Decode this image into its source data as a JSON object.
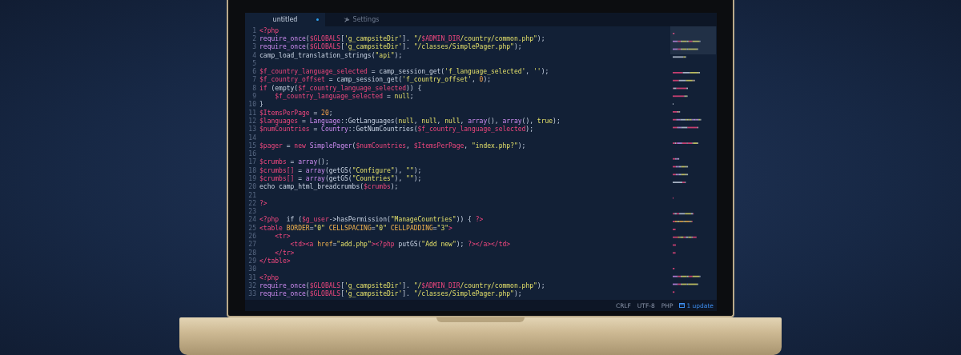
{
  "editor": {
    "tabs": [
      {
        "label": "untitled",
        "selected": true,
        "modified": true,
        "kind": "file"
      },
      {
        "label": "Settings",
        "selected": false,
        "modified": false,
        "kind": "settings"
      }
    ],
    "lines": [
      {
        "number": "1",
        "tokens": [
          {
            "kind": "tag",
            "text": "<?php"
          }
        ]
      },
      {
        "number": "2",
        "tokens": [
          {
            "kind": "func",
            "text": "require_once"
          },
          {
            "kind": "plain",
            "text": "("
          },
          {
            "kind": "var",
            "text": "$GLOBALS"
          },
          {
            "kind": "plain",
            "text": "["
          },
          {
            "kind": "str",
            "text": "'g_campsiteDir'"
          },
          {
            "kind": "plain",
            "text": "]. "
          },
          {
            "kind": "str",
            "text": "\"/"
          },
          {
            "kind": "var",
            "text": "$ADMIN_DIR"
          },
          {
            "kind": "str",
            "text": "/country/common.php\""
          },
          {
            "kind": "plain",
            "text": ");"
          }
        ]
      },
      {
        "number": "3",
        "tokens": [
          {
            "kind": "func",
            "text": "require_once"
          },
          {
            "kind": "plain",
            "text": "("
          },
          {
            "kind": "var",
            "text": "$GLOBALS"
          },
          {
            "kind": "plain",
            "text": "["
          },
          {
            "kind": "str",
            "text": "'g_campsiteDir'"
          },
          {
            "kind": "plain",
            "text": "]. "
          },
          {
            "kind": "str",
            "text": "\"/classes/SimplePager.php\""
          },
          {
            "kind": "plain",
            "text": ");"
          }
        ]
      },
      {
        "number": "4",
        "tokens": [
          {
            "kind": "plain",
            "text": "camp_load_translation_strings("
          },
          {
            "kind": "str",
            "text": "\"api\""
          },
          {
            "kind": "plain",
            "text": ");"
          }
        ]
      },
      {
        "number": "5"
      },
      {
        "number": "6",
        "tokens": [
          {
            "kind": "var",
            "text": "$f_country_language_selected"
          },
          {
            "kind": "plain",
            "text": " = camp_session_get("
          },
          {
            "kind": "str",
            "text": "'f_language_selected'"
          },
          {
            "kind": "plain",
            "text": ", "
          },
          {
            "kind": "str",
            "text": "''"
          },
          {
            "kind": "plain",
            "text": ");"
          }
        ]
      },
      {
        "number": "7",
        "tokens": [
          {
            "kind": "var",
            "text": "$f_country_offset"
          },
          {
            "kind": "plain",
            "text": " = camp_session_get("
          },
          {
            "kind": "str",
            "text": "'f_country_offset'"
          },
          {
            "kind": "plain",
            "text": ", "
          },
          {
            "kind": "num",
            "text": "0"
          },
          {
            "kind": "plain",
            "text": ");"
          }
        ]
      },
      {
        "number": "8",
        "tokens": [
          {
            "kind": "kw",
            "text": "if"
          },
          {
            "kind": "plain",
            "text": " (empty("
          },
          {
            "kind": "var",
            "text": "$f_country_language_selected"
          },
          {
            "kind": "plain",
            "text": ")) {"
          }
        ]
      },
      {
        "number": "9",
        "tokens": [
          {
            "kind": "var",
            "text": "    $f_country_language_selected"
          },
          {
            "kind": "plain",
            "text": " = "
          },
          {
            "kind": "str",
            "text": "null"
          },
          {
            "kind": "plain",
            "text": ";"
          }
        ]
      },
      {
        "number": "10",
        "tokens": [
          {
            "kind": "plain",
            "text": "}"
          }
        ]
      },
      {
        "number": "11",
        "tokens": [
          {
            "kind": "var",
            "text": "$ItemsPerPage"
          },
          {
            "kind": "plain",
            "text": " = "
          },
          {
            "kind": "num",
            "text": "20"
          },
          {
            "kind": "plain",
            "text": ";"
          }
        ]
      },
      {
        "number": "12",
        "tokens": [
          {
            "kind": "var",
            "text": "$languages"
          },
          {
            "kind": "plain",
            "text": " = "
          },
          {
            "kind": "func",
            "text": "Language"
          },
          {
            "kind": "plain",
            "text": "::GetLanguages("
          },
          {
            "kind": "str",
            "text": "null"
          },
          {
            "kind": "plain",
            "text": ", "
          },
          {
            "kind": "str",
            "text": "null"
          },
          {
            "kind": "plain",
            "text": ", "
          },
          {
            "kind": "str",
            "text": "null"
          },
          {
            "kind": "plain",
            "text": ", "
          },
          {
            "kind": "func",
            "text": "array"
          },
          {
            "kind": "plain",
            "text": "(), "
          },
          {
            "kind": "func",
            "text": "array"
          },
          {
            "kind": "plain",
            "text": "(), "
          },
          {
            "kind": "str",
            "text": "true"
          },
          {
            "kind": "plain",
            "text": ");"
          }
        ]
      },
      {
        "number": "13",
        "tokens": [
          {
            "kind": "var",
            "text": "$numCountries"
          },
          {
            "kind": "plain",
            "text": " = "
          },
          {
            "kind": "func",
            "text": "Country"
          },
          {
            "kind": "plain",
            "text": "::GetNumCountries("
          },
          {
            "kind": "var",
            "text": "$f_country_language_selected"
          },
          {
            "kind": "plain",
            "text": ");"
          }
        ]
      },
      {
        "number": "14"
      },
      {
        "number": "15",
        "tokens": [
          {
            "kind": "var",
            "text": "$pager"
          },
          {
            "kind": "plain",
            "text": " = "
          },
          {
            "kind": "kw",
            "text": "new"
          },
          {
            "kind": "func",
            "text": " SimplePager"
          },
          {
            "kind": "plain",
            "text": "("
          },
          {
            "kind": "var",
            "text": "$numCountries"
          },
          {
            "kind": "plain",
            "text": ", "
          },
          {
            "kind": "var",
            "text": "$ItemsPerPage"
          },
          {
            "kind": "plain",
            "text": ", "
          },
          {
            "kind": "str",
            "text": "\"index.php?\""
          },
          {
            "kind": "plain",
            "text": ");"
          }
        ]
      },
      {
        "number": "16"
      },
      {
        "number": "17",
        "tokens": [
          {
            "kind": "var",
            "text": "$crumbs"
          },
          {
            "kind": "plain",
            "text": " = "
          },
          {
            "kind": "func",
            "text": "array"
          },
          {
            "kind": "plain",
            "text": "();"
          }
        ]
      },
      {
        "number": "18",
        "tokens": [
          {
            "kind": "var",
            "text": "$crumbs[]"
          },
          {
            "kind": "plain",
            "text": " = "
          },
          {
            "kind": "func",
            "text": "array"
          },
          {
            "kind": "plain",
            "text": "(getGS("
          },
          {
            "kind": "str",
            "text": "\"Configure\""
          },
          {
            "kind": "plain",
            "text": "), "
          },
          {
            "kind": "str",
            "text": "\"\""
          },
          {
            "kind": "plain",
            "text": ");"
          }
        ]
      },
      {
        "number": "19",
        "tokens": [
          {
            "kind": "var",
            "text": "$crumbs[]"
          },
          {
            "kind": "plain",
            "text": " = "
          },
          {
            "kind": "func",
            "text": "array"
          },
          {
            "kind": "plain",
            "text": "(getGS("
          },
          {
            "kind": "str",
            "text": "\"Countries\""
          },
          {
            "kind": "plain",
            "text": "), "
          },
          {
            "kind": "str",
            "text": "\"\""
          },
          {
            "kind": "plain",
            "text": ");"
          }
        ]
      },
      {
        "number": "20",
        "tokens": [
          {
            "kind": "plain",
            "text": "echo camp_html_breadcrumbs("
          },
          {
            "kind": "var",
            "text": "$crumbs"
          },
          {
            "kind": "plain",
            "text": ");"
          }
        ]
      },
      {
        "number": "21"
      },
      {
        "number": "22",
        "tokens": [
          {
            "kind": "tag",
            "text": "?>"
          }
        ]
      },
      {
        "number": "23"
      },
      {
        "number": "24",
        "tokens": [
          {
            "kind": "tag",
            "text": "<?php"
          },
          {
            "kind": "plain",
            "text": "  if ("
          },
          {
            "kind": "var",
            "text": "$g_user"
          },
          {
            "kind": "plain",
            "text": "->hasPermission("
          },
          {
            "kind": "str",
            "text": "\"ManageCountries\""
          },
          {
            "kind": "plain",
            "text": ")) { "
          },
          {
            "kind": "tag",
            "text": "?>"
          }
        ]
      },
      {
        "number": "25",
        "tokens": [
          {
            "kind": "tag",
            "text": "<table"
          },
          {
            "kind": "attr",
            "text": " BORDER"
          },
          {
            "kind": "plain",
            "text": "="
          },
          {
            "kind": "str",
            "text": "\"0\""
          },
          {
            "kind": "attr",
            "text": " CELLSPACING"
          },
          {
            "kind": "plain",
            "text": "="
          },
          {
            "kind": "str",
            "text": "\"0\""
          },
          {
            "kind": "attr",
            "text": " CELLPADDING"
          },
          {
            "kind": "plain",
            "text": "="
          },
          {
            "kind": "str",
            "text": "\"3\""
          },
          {
            "kind": "tag",
            "text": ">"
          }
        ]
      },
      {
        "number": "26",
        "tokens": [
          {
            "kind": "tag",
            "text": "    <tr>"
          }
        ]
      },
      {
        "number": "27",
        "tokens": [
          {
            "kind": "tag",
            "text": "        <td><a"
          },
          {
            "kind": "attr",
            "text": " href"
          },
          {
            "kind": "plain",
            "text": "="
          },
          {
            "kind": "str",
            "text": "\"add.php\""
          },
          {
            "kind": "tag",
            "text": "><?php"
          },
          {
            "kind": "plain",
            "text": " putGS("
          },
          {
            "kind": "str",
            "text": "\"Add new\""
          },
          {
            "kind": "plain",
            "text": "); "
          },
          {
            "kind": "tag",
            "text": "?></a></td>"
          }
        ]
      },
      {
        "number": "28",
        "tokens": [
          {
            "kind": "tag",
            "text": "    </tr>"
          }
        ]
      },
      {
        "number": "29",
        "tokens": [
          {
            "kind": "tag",
            "text": "</table>"
          }
        ]
      },
      {
        "number": "30"
      },
      {
        "number": "31",
        "tokens": [
          {
            "kind": "tag",
            "text": "<?php"
          }
        ]
      },
      {
        "number": "32",
        "tokens": [
          {
            "kind": "func",
            "text": "require_once"
          },
          {
            "kind": "plain",
            "text": "("
          },
          {
            "kind": "var",
            "text": "$GLOBALS"
          },
          {
            "kind": "plain",
            "text": "["
          },
          {
            "kind": "str",
            "text": "'g_campsiteDir'"
          },
          {
            "kind": "plain",
            "text": "]. "
          },
          {
            "kind": "str",
            "text": "\"/"
          },
          {
            "kind": "var",
            "text": "$ADMIN_DIR"
          },
          {
            "kind": "str",
            "text": "/country/common.php\""
          },
          {
            "kind": "plain",
            "text": ");"
          }
        ]
      },
      {
        "number": "33",
        "tokens": [
          {
            "kind": "func",
            "text": "require_once"
          },
          {
            "kind": "plain",
            "text": "("
          },
          {
            "kind": "var",
            "text": "$GLOBALS"
          },
          {
            "kind": "plain",
            "text": "["
          },
          {
            "kind": "str",
            "text": "'g_campsiteDir'"
          },
          {
            "kind": "plain",
            "text": "]. "
          },
          {
            "kind": "str",
            "text": "\"/classes/SimplePager.php\""
          },
          {
            "kind": "plain",
            "text": ");"
          }
        ]
      }
    ],
    "status_bar": {
      "line_ending": "CRLF",
      "encoding": "UTF-8",
      "grammar": "PHP",
      "updates": "1 update"
    }
  }
}
